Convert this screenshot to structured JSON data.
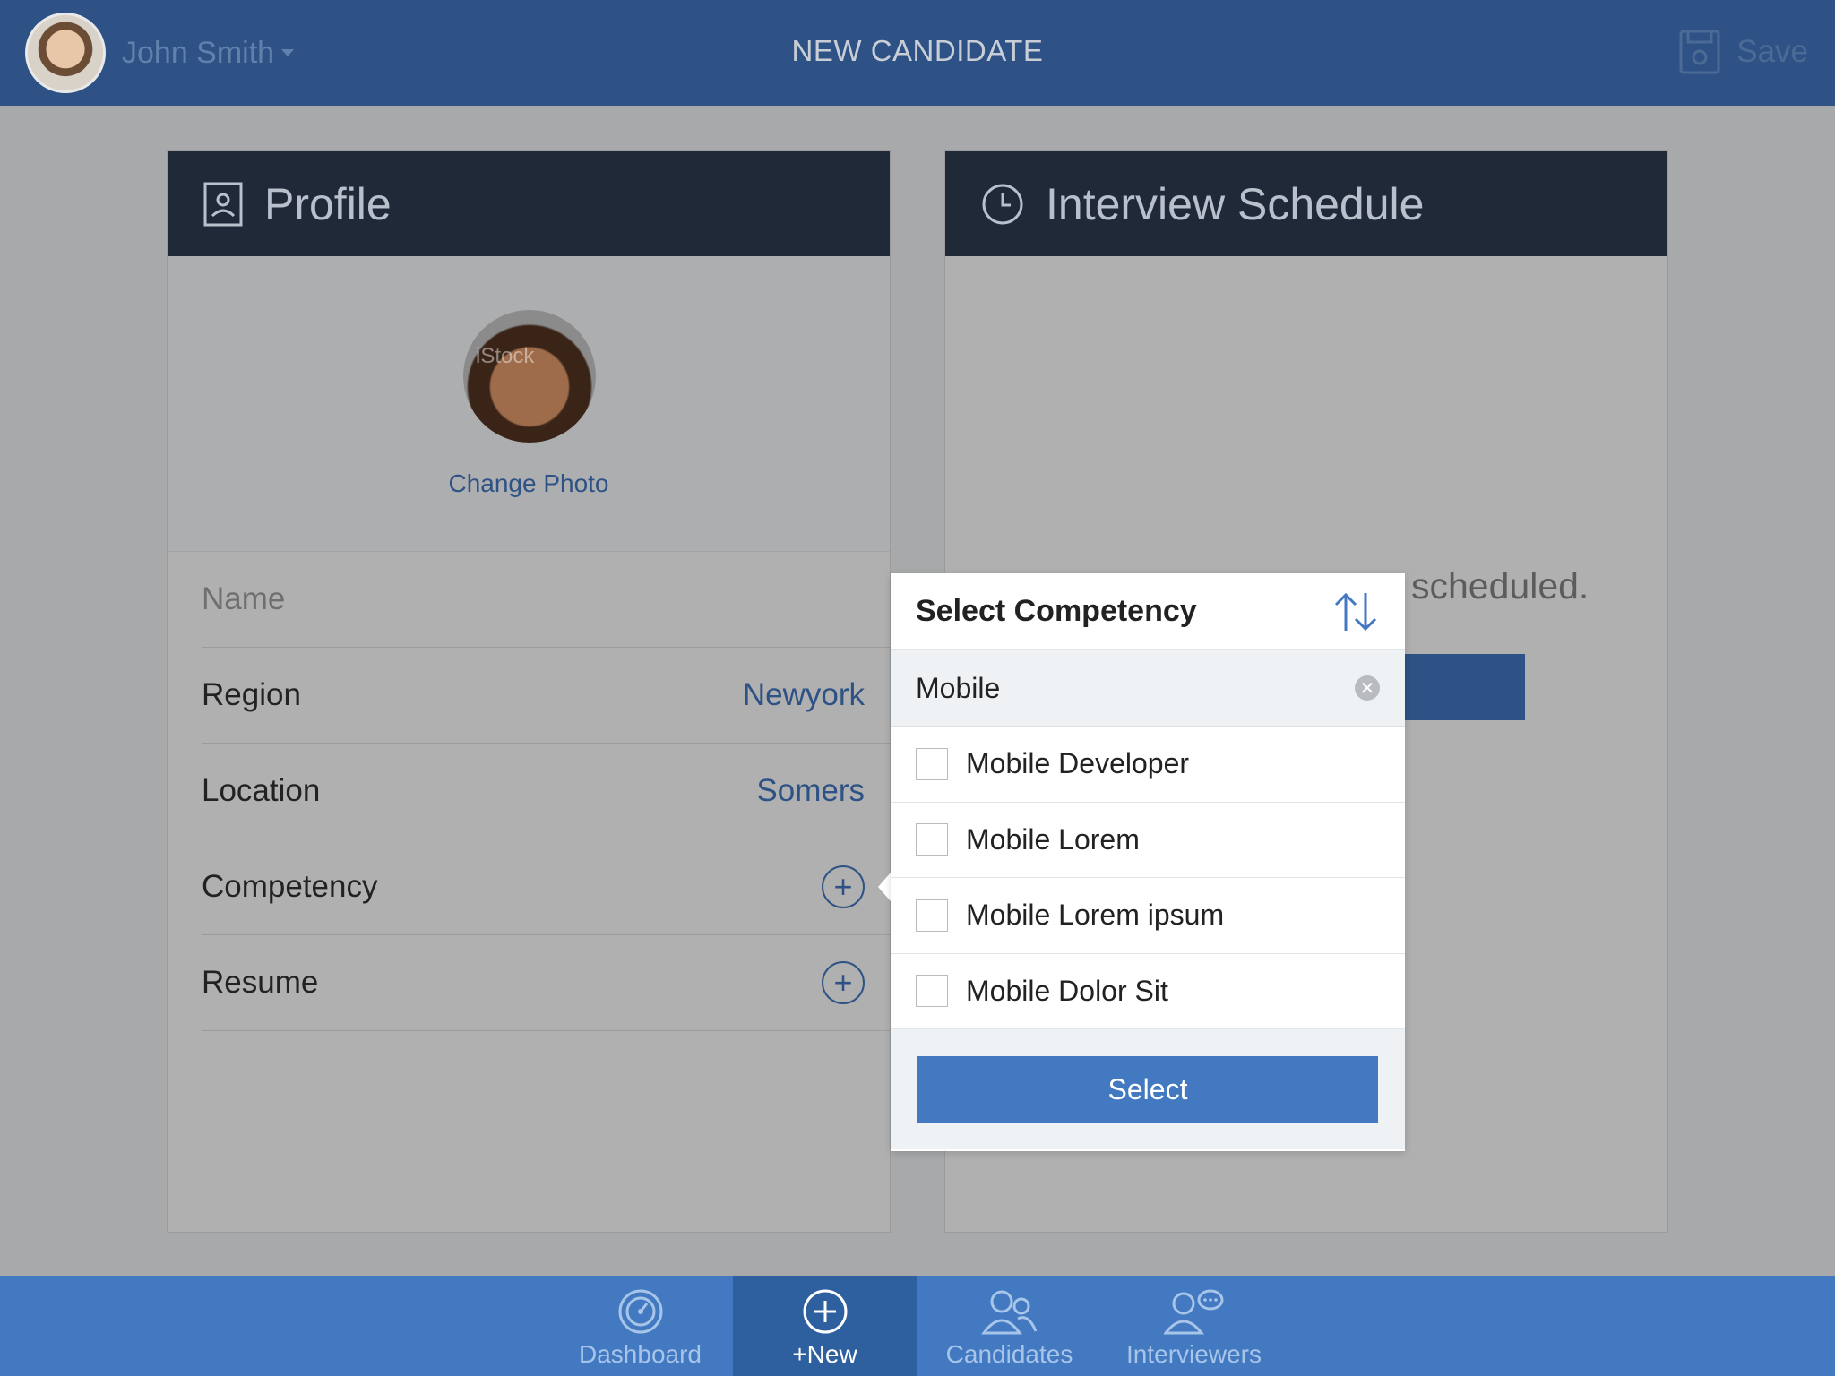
{
  "header": {
    "user_name": "John Smith",
    "page_title": "NEW CANDIDATE",
    "save_label": "Save"
  },
  "profile": {
    "title": "Profile",
    "change_photo": "Change Photo",
    "photo_watermark": "iStock",
    "name_placeholder": "Name",
    "region_label": "Region",
    "region_value": "Newyork",
    "location_label": "Location",
    "location_value": "Somers",
    "competency_label": "Competency",
    "resume_label": "Resume"
  },
  "schedule": {
    "title": "Interview Schedule",
    "empty_text": "scheduled."
  },
  "popover": {
    "title": "Select Competency",
    "search_value": "Mobile",
    "options": [
      {
        "label": "Mobile Developer",
        "checked": false
      },
      {
        "label": "Mobile Lorem",
        "checked": false
      },
      {
        "label": "Mobile Lorem ipsum",
        "checked": false
      },
      {
        "label": "Mobile Dolor Sit",
        "checked": false
      }
    ],
    "select_label": "Select"
  },
  "tabs": [
    {
      "label": "Dashboard",
      "icon": "dashboard-icon",
      "active": false
    },
    {
      "label": "+New",
      "icon": "plus-circle-icon",
      "active": true
    },
    {
      "label": "Candidates",
      "icon": "candidates-icon",
      "active": false
    },
    {
      "label": "Interviewers",
      "icon": "interviewers-icon",
      "active": false
    }
  ],
  "colors": {
    "header": "#2e5285",
    "card_header": "#1f2938",
    "accent": "#4279c1",
    "link": "#2e5285"
  }
}
